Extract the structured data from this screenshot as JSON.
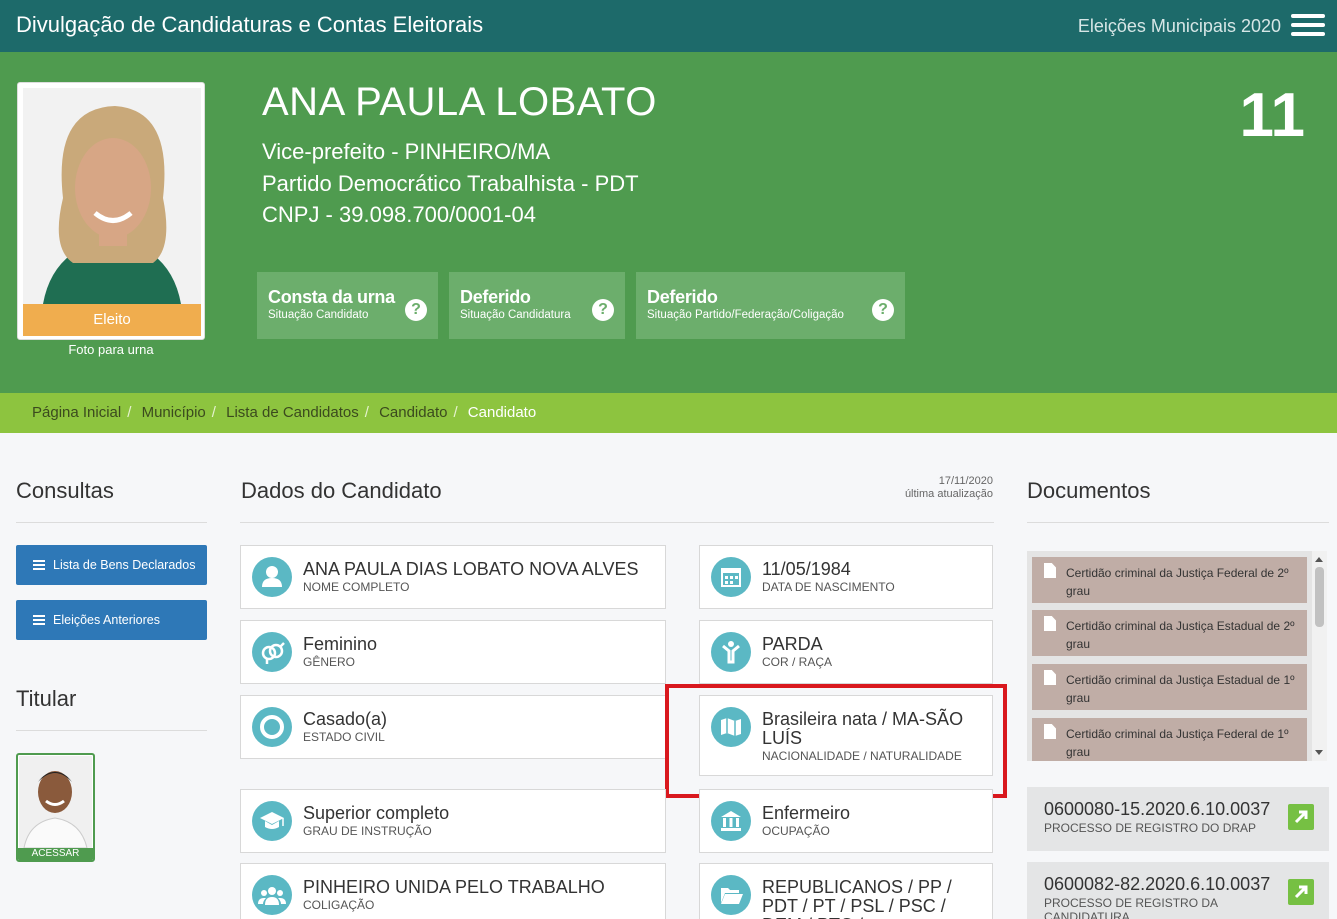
{
  "topbar": {
    "title": "Divulgação de Candidaturas e Contas Eleitorais",
    "election": "Eleições Municipais 2020"
  },
  "candidate": {
    "ballot_name": "ANA PAULA LOBATO",
    "office_line": "Vice-prefeito - PINHEIRO/MA",
    "party_line": "Partido Democrático Trabalhista - PDT",
    "cnpj_line": "CNPJ - 39.098.700/0001-04",
    "number": "11",
    "result_badge": "Eleito",
    "photo_caption": "Foto para urna"
  },
  "status_boxes": [
    {
      "value": "Consta da urna",
      "label": "Situação Candidato"
    },
    {
      "value": "Deferido",
      "label": "Situação Candidatura"
    },
    {
      "value": "Deferido",
      "label": "Situação Partido/Federação/Coligação"
    }
  ],
  "breadcrumb": [
    "Página Inicial",
    "Município",
    "Lista de Candidatos",
    "Candidato",
    "Candidato"
  ],
  "consultas": {
    "title": "Consultas",
    "buttons": [
      "Lista de Bens Declarados",
      "Eleições Anteriores"
    ]
  },
  "titular": {
    "title": "Titular",
    "action": "ACESSAR"
  },
  "dados": {
    "title": "Dados do Candidato",
    "updated_date": "17/11/2020",
    "updated_label": "última atualização",
    "fields": [
      {
        "value": "ANA PAULA DIAS LOBATO NOVA ALVES",
        "label": "NOME COMPLETO",
        "icon": "user-icon"
      },
      {
        "value": "11/05/1984",
        "label": "DATA DE NASCIMENTO",
        "icon": "calendar-icon"
      },
      {
        "value": "Feminino",
        "label": "GÊNERO",
        "icon": "gender-icon"
      },
      {
        "value": "PARDA",
        "label": "COR / RAÇA",
        "icon": "person-arms-up-icon"
      },
      {
        "value": "Casado(a)",
        "label": "ESTADO CIVIL",
        "icon": "ring-icon"
      },
      {
        "value": "Brasileira nata / MA-SÃO LUÍS",
        "label": "NACIONALIDADE / NATURALIDADE",
        "icon": "map-icon"
      },
      {
        "value": "Superior completo",
        "label": "GRAU DE INSTRUÇÃO",
        "icon": "graduation-cap-icon"
      },
      {
        "value": "Enfermeiro",
        "label": "OCUPAÇÃO",
        "icon": "institution-icon"
      },
      {
        "value": "PINHEIRO UNIDA PELO TRABALHO",
        "label": "COLIGAÇÃO",
        "icon": "group-icon"
      },
      {
        "value": "REPUBLICANOS / PP / PDT / PT / PSL / PSC / DEM / PTC /",
        "label": "",
        "icon": "folder-open-icon"
      }
    ]
  },
  "documentos": {
    "title": "Documentos",
    "items": [
      "Certidão criminal da Justiça Federal de 2º grau",
      "Certidão criminal da Justiça Estadual de 2º grau",
      "Certidão criminal da Justiça Estadual de 1º grau",
      "Certidão criminal da Justiça Federal de 1º grau"
    ],
    "processes": [
      {
        "number": "0600080-15.2020.6.10.0037",
        "label": "PROCESSO DE REGISTRO DO DRAP"
      },
      {
        "number": "0600082-82.2020.6.10.0037",
        "label": "PROCESSO DE REGISTRO DA CANDIDATURA"
      }
    ]
  },
  "colors": {
    "topbar": "#1d6a6a",
    "header_green": "#4f9b4f",
    "breadcrumb_lime": "#8dc43f",
    "button_blue": "#2e78b7",
    "icon_teal": "#5bb8c4",
    "elected_orange": "#f0ad4e",
    "highlight_red": "#d9181e"
  }
}
